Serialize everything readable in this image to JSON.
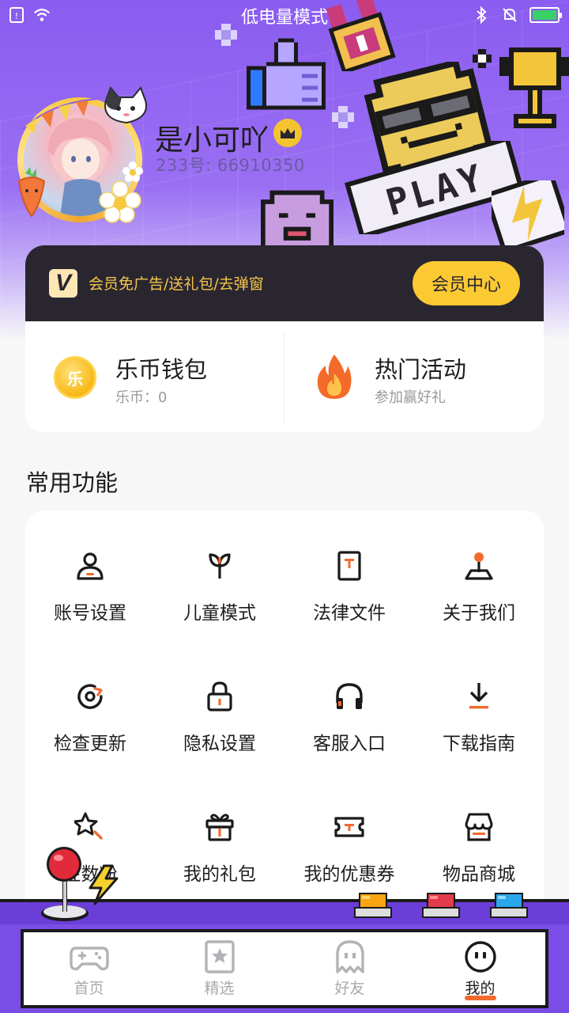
{
  "status_bar": {
    "mode_text": "低电量模式",
    "battery_color": "#37d168"
  },
  "profile": {
    "username": "是小可吖",
    "user_id": "233号: 66910350",
    "badge_icon": "crown-icon"
  },
  "hero_decor": {
    "play_text": "PLAY"
  },
  "vip": {
    "logo_text": "V",
    "promo_text": "会员免广告/送礼包/去弹窗",
    "button_label": "会员中心",
    "accent_color": "#fbc932"
  },
  "wallet": {
    "coin_title": "乐币钱包",
    "coin_sub": "乐币：0",
    "coin_glyph": "乐",
    "activity_title": "热门活动",
    "activity_sub": "参加赢好礼"
  },
  "common_functions": {
    "title": "常用功能",
    "items": [
      {
        "label": "账号设置",
        "icon": "user-icon"
      },
      {
        "label": "儿童模式",
        "icon": "sprout-icon"
      },
      {
        "label": "法律文件",
        "icon": "document-icon"
      },
      {
        "label": "关于我们",
        "icon": "joystick-icon"
      },
      {
        "label": "检查更新",
        "icon": "refresh-icon"
      },
      {
        "label": "隐私设置",
        "icon": "lock-icon"
      },
      {
        "label": "客服入口",
        "icon": "headset-icon"
      },
      {
        "label": "下载指南",
        "icon": "download-icon"
      },
      {
        "label": "性数粉",
        "icon": "star-search-icon"
      },
      {
        "label": "我的礼包",
        "icon": "gift-icon"
      },
      {
        "label": "我的优惠券",
        "icon": "ticket-icon"
      },
      {
        "label": "物品商城",
        "icon": "store-icon"
      }
    ]
  },
  "tabbar": {
    "tabs": [
      {
        "label": "首页",
        "icon": "gamepad-icon",
        "active": false
      },
      {
        "label": "精选",
        "icon": "star-card-icon",
        "active": false
      },
      {
        "label": "好友",
        "icon": "ghost-icon",
        "active": false
      },
      {
        "label": "我的",
        "icon": "face-icon",
        "active": true
      }
    ],
    "active_color": "#f26a2e"
  }
}
